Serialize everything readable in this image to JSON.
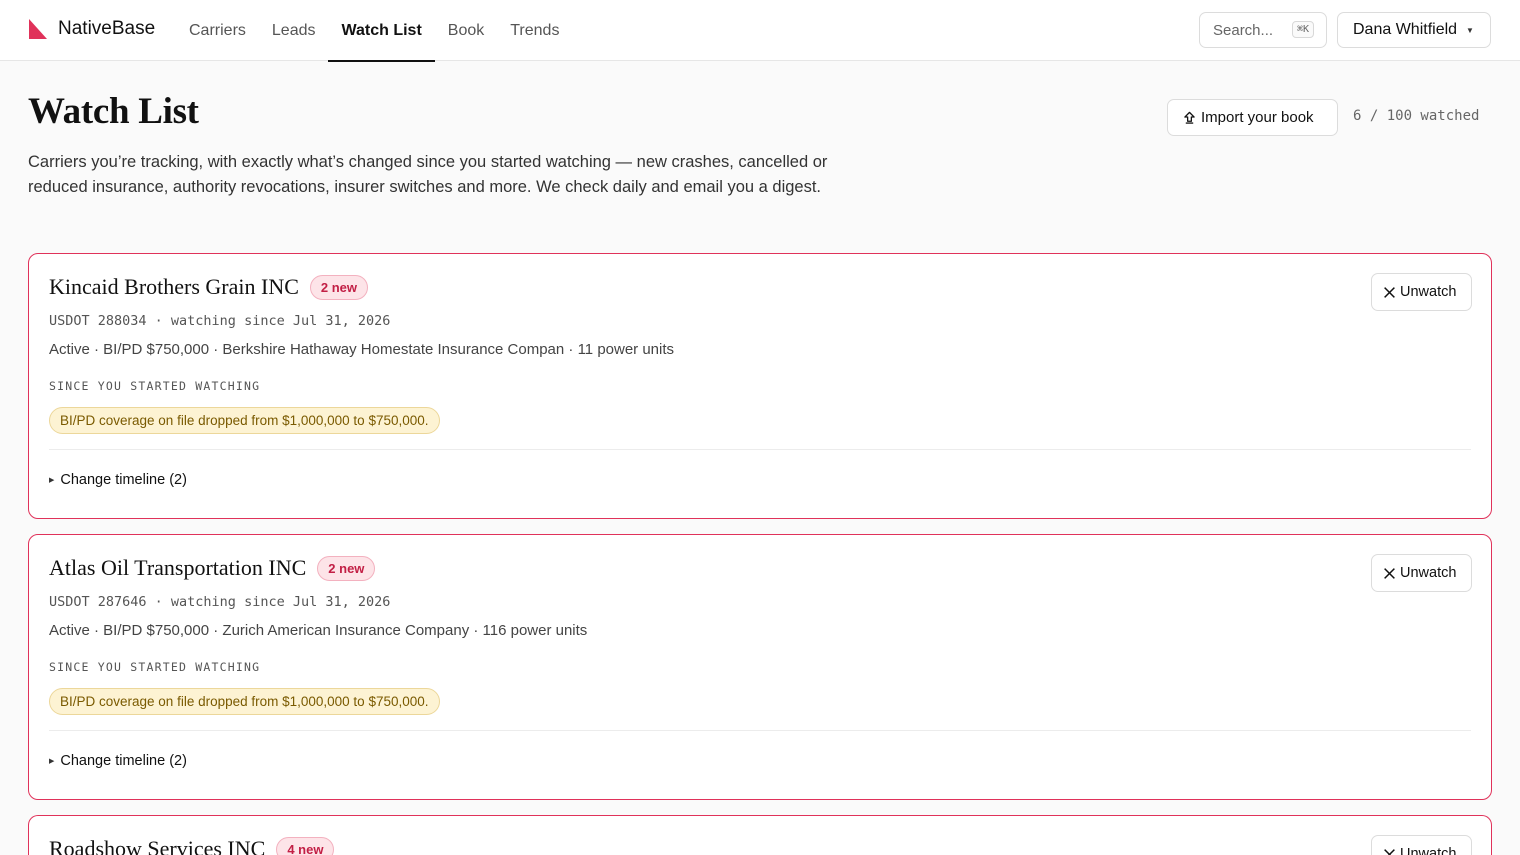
{
  "header": {
    "brand": "NativeBase",
    "nav": [
      {
        "label": "Carriers",
        "active": false
      },
      {
        "label": "Leads",
        "active": false
      },
      {
        "label": "Watch List",
        "active": true
      },
      {
        "label": "Book",
        "active": false
      },
      {
        "label": "Trends",
        "active": false
      }
    ],
    "search_placeholder": "Search...",
    "search_shortcut": "⌘K",
    "user_name": "Dana Whitfield"
  },
  "page": {
    "title": "Watch List",
    "import_label": "Import your book",
    "watch_count": "6 / 100 watched",
    "intro": "Carriers you’re tracking, with exactly what’s changed since you started watching — new crashes, cancelled or reduced insurance, authority revocations, insurer switches and more. We check daily and email you a digest."
  },
  "cards": [
    {
      "name": "Kincaid Brothers Grain INC",
      "badge": "2 new",
      "meta": "USDOT 288034 · watching since Jul 31, 2026",
      "details": "Active · BI/PD $750,000 · Berkshire Hathaway Homestate Insurance Compan · 11 power units",
      "section_label": "SINCE YOU STARTED WATCHING",
      "change": "BI/PD coverage on file dropped from $1,000,000 to $750,000.",
      "timeline": "Change timeline (2)",
      "unwatch": "Unwatch"
    },
    {
      "name": "Atlas Oil Transportation INC",
      "badge": "2 new",
      "meta": "USDOT 287646 · watching since Jul 31, 2026",
      "details": "Active · BI/PD $750,000 · Zurich American Insurance Company · 116 power units",
      "section_label": "SINCE YOU STARTED WATCHING",
      "change": "BI/PD coverage on file dropped from $1,000,000 to $750,000.",
      "timeline": "Change timeline (2)",
      "unwatch": "Unwatch"
    },
    {
      "name": "Roadshow Services INC",
      "badge": "4 new",
      "unwatch": "Unwatch"
    }
  ],
  "colors": {
    "accent": "#e0325a",
    "badge_bg": "#fde4e8",
    "chip_bg": "#fdf3d3"
  }
}
